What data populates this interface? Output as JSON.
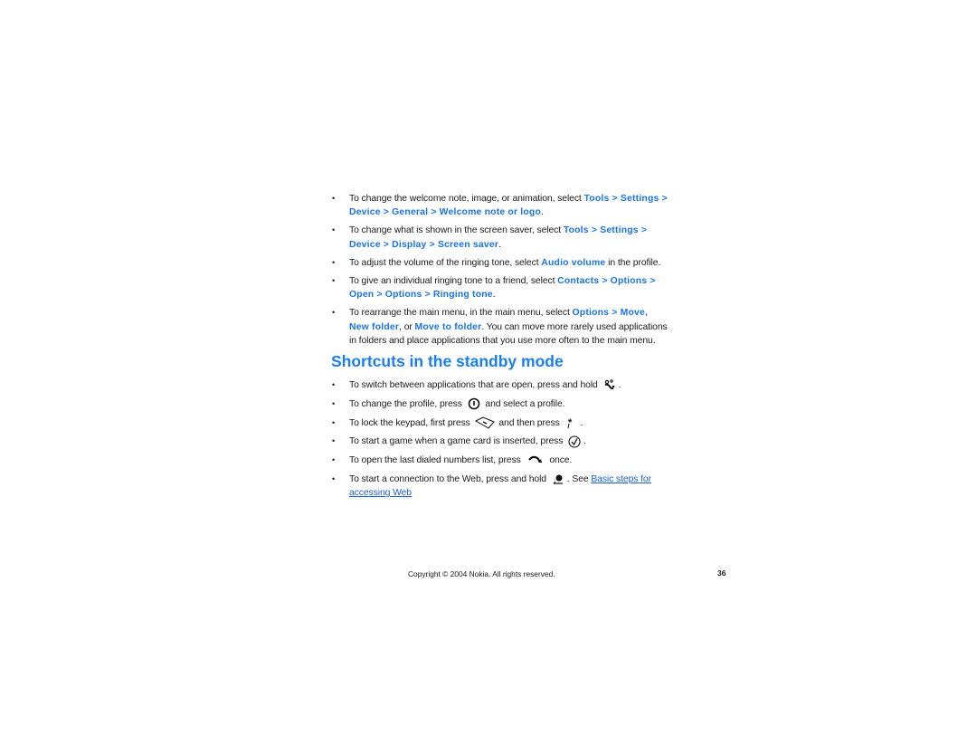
{
  "list1": [
    {
      "pre": "To change the welcome note, image, or animation, select ",
      "ui": "Tools > Settings > Device > General > Welcome note or logo",
      "post": "."
    },
    {
      "pre": "To change what is shown in the screen saver, select ",
      "ui": "Tools > Settings > Device > Display > Screen saver",
      "post": "."
    },
    {
      "pre": "To adjust the volume of the ringing tone, select ",
      "ui": "Audio volume",
      "post": " in the profile."
    },
    {
      "pre": "To give an individual ringing tone to a friend, select ",
      "ui": "Contacts > Options > Open > Options > Ringing tone",
      "post": "."
    },
    {
      "pre": "To rearrange the main menu, in the main menu, select ",
      "ui": "Options > Move,",
      "mid": " ",
      "ui2": "New folder",
      "mid2": ", or ",
      "ui3": "Move to folder",
      "post": ". You can move more rarely used applications in folders and place applications that you use more often to the main menu."
    }
  ],
  "heading": "Shortcuts in the standby mode",
  "list2": [
    {
      "pre": "To switch between applications that are open, press and hold ",
      "icon": "menu-key-icon",
      "post": "."
    },
    {
      "pre": "To change the profile, press ",
      "icon": "power-key-icon",
      "post": " and select a profile."
    },
    {
      "pre": "To lock the keypad, first press ",
      "icon": "left-selection-key-icon",
      "mid": " and then press ",
      "icon2": "star-key-icon",
      "post": "."
    },
    {
      "pre": "To start a game when a game card is inserted, press ",
      "icon": "ok-key-icon",
      "post": "."
    },
    {
      "pre": "To open the last dialed numbers list, press ",
      "icon": "call-key-icon",
      "post": " once."
    },
    {
      "pre": "To start a connection to the Web, press and hold ",
      "icon": "zero-key-icon",
      "post": ". See ",
      "link": "Basic steps for accessing Web"
    }
  ],
  "footer": {
    "copyright": "Copyright © 2004 Nokia. All rights reserved.",
    "page_number": "36"
  },
  "colors": {
    "accent": "#1a73e8",
    "heading": "#1a7ef0"
  }
}
